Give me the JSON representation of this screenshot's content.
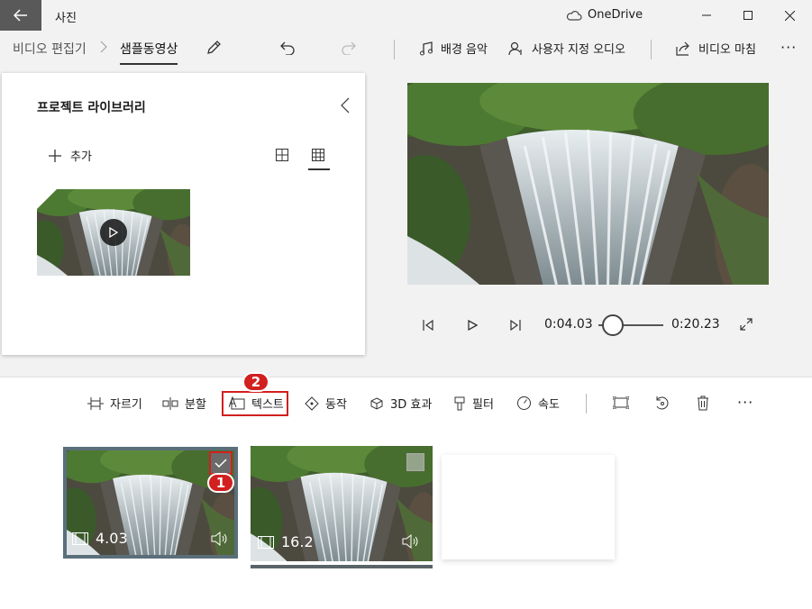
{
  "app": {
    "title": "사진",
    "cloud_label": "OneDrive"
  },
  "breadcrumb": {
    "root": "비디오 편집기",
    "current": "샘플동영상"
  },
  "toolbar": {
    "background_music": "배경 음악",
    "custom_audio": "사용자 지정 오디오",
    "finish_video": "비디오 마침",
    "more": "···"
  },
  "library": {
    "title": "프로젝트 라이브러리",
    "add_label": "추가"
  },
  "player": {
    "current_time": "0:04.03",
    "total_time": "0:20.23",
    "progress": 0.2
  },
  "storyboard": {
    "tools": {
      "trim": "자르기",
      "split": "분할",
      "text": "텍스트",
      "motion": "동작",
      "effects3d": "3D 효과",
      "filters": "필터",
      "speed": "속도"
    },
    "more": "···",
    "clips": [
      {
        "duration": "4.03",
        "selected": true
      },
      {
        "duration": "16.2",
        "selected": false
      }
    ],
    "annotations": {
      "badge1": "1",
      "badge2": "2"
    }
  },
  "colors": {
    "accent_red": "#d21f1f",
    "back_button": "#595959"
  }
}
